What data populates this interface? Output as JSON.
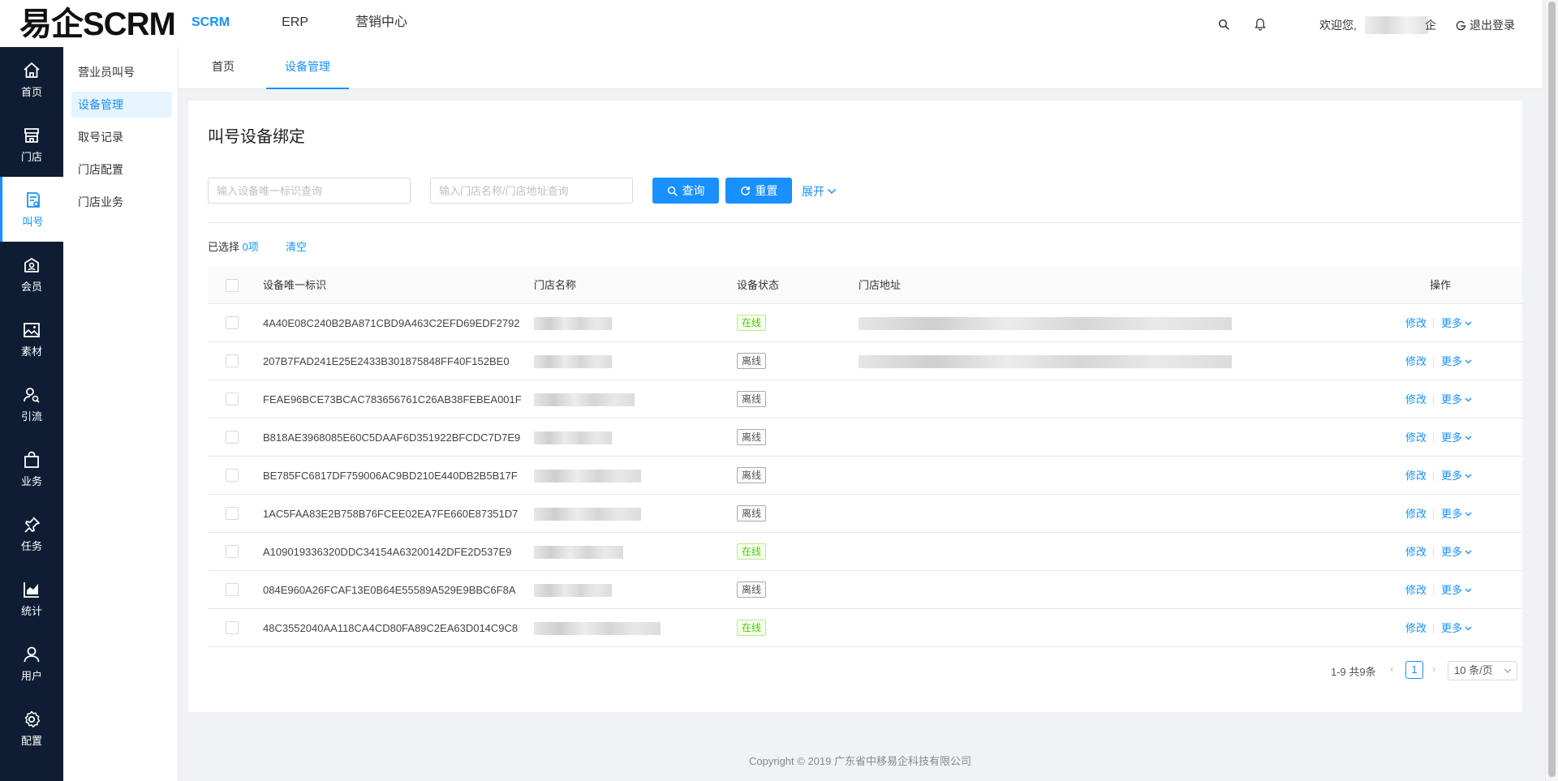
{
  "app": {
    "logo": "易企SCRM"
  },
  "topnav": [
    {
      "label": "SCRM",
      "active": true
    },
    {
      "label": "ERP",
      "active": false
    },
    {
      "label": "营销中心",
      "active": false
    }
  ],
  "header": {
    "welcome": "欢迎您,",
    "name_tail": "企",
    "logout": "退出登录"
  },
  "sidebar": [
    {
      "label": "首页",
      "icon": "home-icon"
    },
    {
      "label": "门店",
      "icon": "store-icon"
    },
    {
      "label": "叫号",
      "icon": "call-number-icon",
      "active": true
    },
    {
      "label": "会员",
      "icon": "member-icon"
    },
    {
      "label": "素材",
      "icon": "image-icon"
    },
    {
      "label": "引流",
      "icon": "traffic-icon"
    },
    {
      "label": "业务",
      "icon": "bag-icon"
    },
    {
      "label": "任务",
      "icon": "pin-icon"
    },
    {
      "label": "统计",
      "icon": "chart-icon"
    },
    {
      "label": "用户",
      "icon": "user-icon"
    },
    {
      "label": "配置",
      "icon": "gear-icon"
    }
  ],
  "submenu": [
    {
      "label": "营业员叫号"
    },
    {
      "label": "设备管理",
      "active": true
    },
    {
      "label": "取号记录"
    },
    {
      "label": "门店配置"
    },
    {
      "label": "门店业务"
    }
  ],
  "tabs": [
    {
      "label": "首页"
    },
    {
      "label": "设备管理",
      "active": true
    }
  ],
  "main": {
    "title": "叫号设备绑定",
    "search_device_placeholder": "输入设备唯一标识查询",
    "search_store_placeholder": "输入门店名称/门店地址查询",
    "query_btn": "查询",
    "reset_btn": "重置",
    "expand": "展开",
    "selected_prefix": "已选择",
    "selected_count": "0项",
    "clear": "清空"
  },
  "table": {
    "columns": [
      "设备唯一标识",
      "门店名称",
      "设备状态",
      "门店地址",
      "操作"
    ],
    "edit_label": "修改",
    "more_label": "更多",
    "rows": [
      {
        "device_id": "4A40E08C240B2BA871CBD9A463C2EFD69EDF2792",
        "status": "在线",
        "online": true,
        "has_address": true
      },
      {
        "device_id": "207B7FAD241E25E2433B301875848FF40F152BE0",
        "status": "离线",
        "online": false,
        "has_address": true
      },
      {
        "device_id": "FEAE96BCE73BCAC783656761C26AB38FEBEA001F",
        "status": "离线",
        "online": false,
        "has_address": false
      },
      {
        "device_id": "B818AE3968085E60C5DAAF6D351922BFCDC7D7E9",
        "status": "离线",
        "online": false,
        "has_address": false
      },
      {
        "device_id": "BE785FC6817DF759006AC9BD210E440DB2B5B17F",
        "status": "离线",
        "online": false,
        "has_address": false
      },
      {
        "device_id": "1AC5FAA83E2B758B76FCEE02EA7FE660E87351D7",
        "status": "离线",
        "online": false,
        "has_address": false
      },
      {
        "device_id": "A109019336320DDC34154A63200142DFE2D537E9",
        "status": "在线",
        "online": true,
        "has_address": false
      },
      {
        "device_id": "084E960A26FCAF13E0B64E55589A529E9BBC6F8A",
        "status": "离线",
        "online": false,
        "has_address": false
      },
      {
        "device_id": "48C3552040AA118CA4CD80FA89C2EA63D014C9C8",
        "status": "在线",
        "online": true,
        "has_address": false
      }
    ]
  },
  "pagination": {
    "total": "1-9 共9条",
    "current": "1",
    "page_size": "10 条/页"
  },
  "footer": {
    "copyright": "Copyright © 2019 广东省中移易企科技有限公司"
  },
  "colors": {
    "primary": "#1890ff",
    "sidebar_bg": "#0e1d33",
    "online": "#52c41a"
  }
}
